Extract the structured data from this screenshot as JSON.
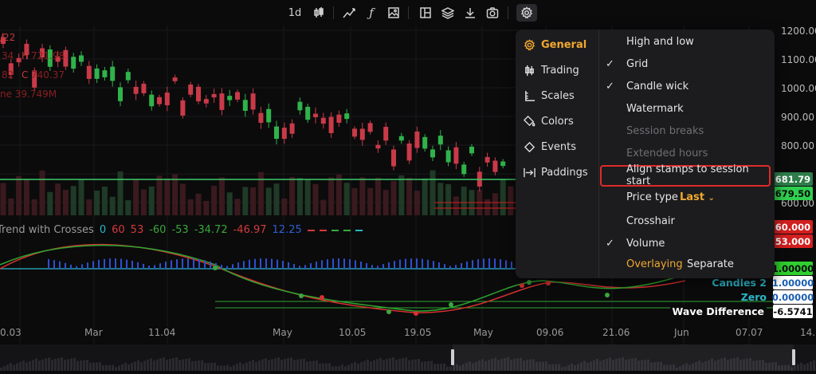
{
  "toolbar": {
    "interval": "1d",
    "items": [
      "candles-icon",
      "drawing-icon",
      "function-icon",
      "image-icon",
      "layout-icon",
      "layers-icon",
      "download-icon",
      "camera-icon",
      "settings-icon"
    ]
  },
  "overlay": {
    "date_fragment": "/22",
    "high_label": "H",
    "high_value": "721.98",
    "close_label": "C",
    "close_value": "740.37",
    "volume_fragment": "ne 39.749M",
    "left_open_fragment": "34",
    "left_low_fragment": "82"
  },
  "legend": {
    "title": "Trend with Crosses",
    "values": [
      "0",
      "60",
      "53",
      "-60",
      "-53",
      "-34.72",
      "-46.97",
      "12.25"
    ],
    "colors": [
      "#2ab6c8",
      "#d63a3a",
      "#d63a3a",
      "#3aa83a",
      "#3aa83a",
      "#3aa83a",
      "#d63a3a",
      "#2f5fd0"
    ]
  },
  "price_axis": {
    "labels": [
      "1200.00",
      "1100.00",
      "1000.00",
      "900.00",
      "800.00",
      "600.00"
    ],
    "tags": [
      {
        "text": "681.79",
        "bg": "#2e7d4a",
        "fg": "#ffffff"
      },
      {
        "text": "679.50",
        "bg": "#2fcf4f",
        "fg": "#0b0b0c"
      }
    ]
  },
  "indicator_axis": {
    "tags": [
      {
        "text": "60.000",
        "bg": "#d21f1f",
        "fg": "#ffffff"
      },
      {
        "text": "53.000",
        "bg": "#d21f1f",
        "fg": "#ffffff"
      },
      {
        "text": "1.00000",
        "bg": "#2fcf2f",
        "fg": "#0b0b0c"
      },
      {
        "text": "1.00000",
        "bg": "#ffffff",
        "fg": "#1a5fb0"
      },
      {
        "text": "0.00000",
        "bg": "#ffffff",
        "fg": "#1a5fb0"
      },
      {
        "text": "-6.5741",
        "bg": "#ffffff",
        "fg": "#0b0b0c"
      }
    ],
    "labels": [
      {
        "text": "Candles 2",
        "color": "#2ab6c8"
      },
      {
        "text": "Zero",
        "color": "#2ab6c8"
      },
      {
        "text": "Wave Difference",
        "color": "#ffffff"
      }
    ]
  },
  "time_axis": [
    "0.03",
    "Mar",
    "11.04",
    "May",
    "10.05",
    "19.05",
    "May",
    "09.06",
    "21.06",
    "Jun",
    "07.07",
    "14."
  ],
  "settings": {
    "categories": [
      {
        "label": "General",
        "icon": "gear-icon",
        "active": true
      },
      {
        "label": "Trading",
        "icon": "trading-icon",
        "active": false
      },
      {
        "label": "Scales",
        "icon": "scales-icon",
        "active": false
      },
      {
        "label": "Colors",
        "icon": "colors-icon",
        "active": false
      },
      {
        "label": "Events",
        "icon": "events-icon",
        "active": false
      },
      {
        "label": "Paddings",
        "icon": "paddings-icon",
        "active": false
      }
    ],
    "options": [
      {
        "label": "High and low",
        "checked": false,
        "enabled": true
      },
      {
        "label": "Grid",
        "checked": true,
        "enabled": true
      },
      {
        "label": "Candle wick",
        "checked": true,
        "enabled": true
      },
      {
        "label": "Watermark",
        "checked": false,
        "enabled": true
      },
      {
        "label": "Session breaks",
        "checked": false,
        "enabled": false
      },
      {
        "label": "Extended hours",
        "checked": false,
        "enabled": false
      },
      {
        "label": "Align stamps to session start",
        "checked": false,
        "enabled": true,
        "highlighted": true
      },
      {
        "label": "Price type",
        "checked": false,
        "enabled": true,
        "value": "Last"
      },
      {
        "label": "Crosshair",
        "checked": false,
        "enabled": true
      },
      {
        "label": "Volume",
        "checked": true,
        "enabled": true
      }
    ],
    "volume_modes": {
      "active": "Overlaying",
      "other": "Separate"
    },
    "accent": "#f0a830",
    "highlight": "#e02a2a"
  }
}
